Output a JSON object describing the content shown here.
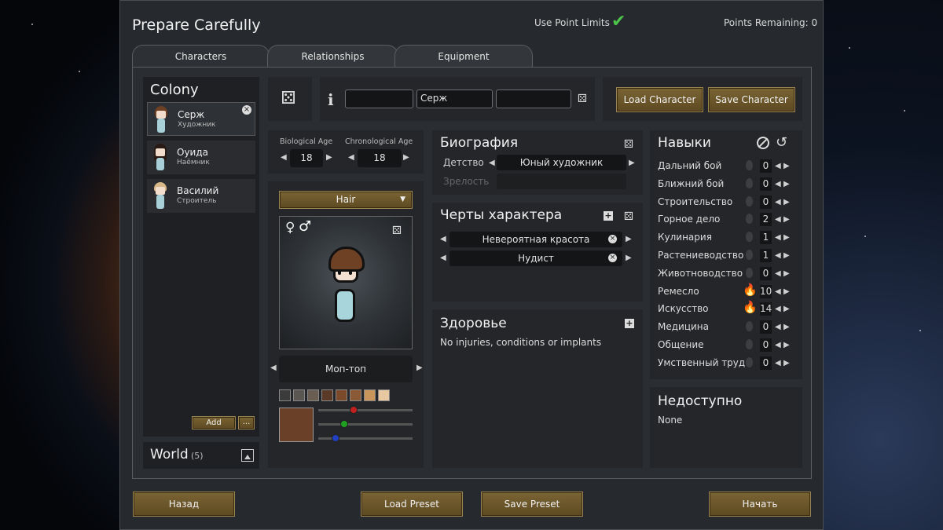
{
  "header": {
    "title": "Prepare Carefully",
    "use_point_limits": "Use Point Limits",
    "points_remaining": "Points Remaining: 0"
  },
  "tabs": [
    {
      "label": "Characters"
    },
    {
      "label": "Relationships"
    },
    {
      "label": "Equipment"
    }
  ],
  "colony": {
    "title": "Colony",
    "pawns": [
      {
        "name": "Серж",
        "role": "Художник"
      },
      {
        "name": "Оуида",
        "role": "Наёмник"
      },
      {
        "name": "Василий",
        "role": "Строитель"
      }
    ],
    "add_label": "Add",
    "more_label": "...",
    "world_label": "World",
    "world_count": "(5)"
  },
  "name_fields": {
    "first": "",
    "nick": "Серж",
    "last": ""
  },
  "buttons": {
    "load_character": "Load Character",
    "save_character": "Save Character"
  },
  "age": {
    "bio_label": "Biological Age",
    "bio_value": "18",
    "chrono_label": "Chronological Age",
    "chrono_value": "18"
  },
  "appearance": {
    "layer": "Hair",
    "hair_style": "Моп-топ",
    "swatches": [
      "#3b3b3b",
      "#5a5652",
      "#6a5e52",
      "#5a3a26",
      "#7a4a2a",
      "#8a5a36",
      "#c8955a",
      "#e8c8a0"
    ],
    "selected_color": "#6a4028",
    "slider_r": 0.36,
    "slider_g": 0.25,
    "slider_b": 0.15
  },
  "biography": {
    "title": "Биография",
    "childhood_label": "Детство",
    "childhood_value": "Юный художник",
    "adulthood_label": "Зрелость",
    "adulthood_value": ""
  },
  "traits": {
    "title": "Черты характера",
    "items": [
      {
        "label": "Невероятная красота"
      },
      {
        "label": "Нудист"
      }
    ]
  },
  "health": {
    "title": "Здоровье",
    "text": "No injuries, conditions or implants"
  },
  "skills": {
    "title": "Навыки",
    "items": [
      {
        "name": "Дальний бой",
        "value": "0",
        "passion": ""
      },
      {
        "name": "Ближний бой",
        "value": "0",
        "passion": ""
      },
      {
        "name": "Строительство",
        "value": "0",
        "passion": ""
      },
      {
        "name": "Горное дело",
        "value": "2",
        "passion": ""
      },
      {
        "name": "Кулинария",
        "value": "1",
        "passion": ""
      },
      {
        "name": "Растениеводство",
        "value": "1",
        "passion": ""
      },
      {
        "name": "Животноводство",
        "value": "0",
        "passion": ""
      },
      {
        "name": "Ремесло",
        "value": "10",
        "passion": "major"
      },
      {
        "name": "Искусство",
        "value": "14",
        "passion": "major"
      },
      {
        "name": "Медицина",
        "value": "0",
        "passion": ""
      },
      {
        "name": "Общение",
        "value": "0",
        "passion": ""
      },
      {
        "name": "Умственный труд",
        "value": "0",
        "passion": ""
      }
    ]
  },
  "incapable": {
    "title": "Недоступно",
    "text": "None"
  },
  "footer": {
    "back": "Назад",
    "load_preset": "Load Preset",
    "save_preset": "Save Preset",
    "start": "Начать"
  },
  "colors": {
    "accent_button": "#6e5a2c",
    "check": "#4cc24c",
    "window_bg": "#26292d"
  }
}
